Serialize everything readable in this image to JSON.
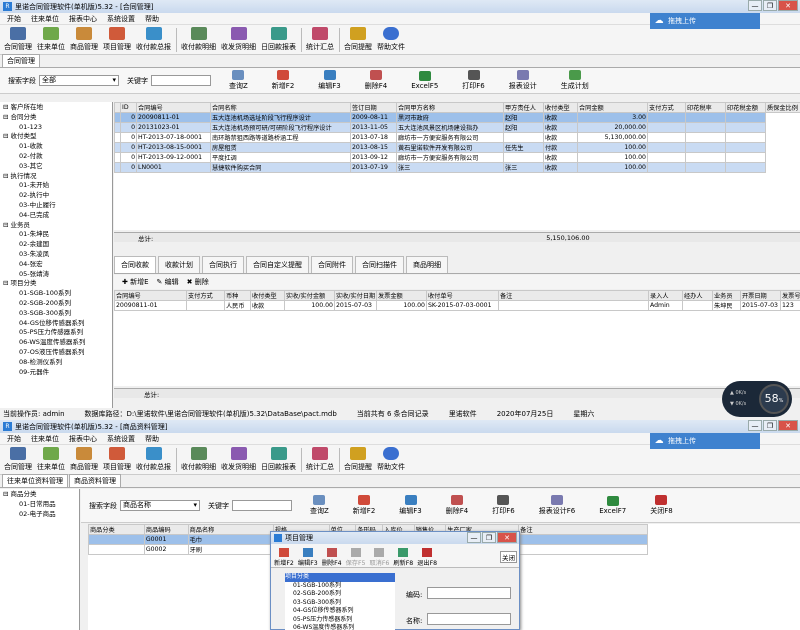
{
  "top": {
    "title": "里诺合同管理软件(单机版)5.32 - [合同管理]",
    "window_controls": [
      "—",
      "❐",
      "✕"
    ],
    "menu": [
      "开始",
      "往来单位",
      "报表中心",
      "系统设置",
      "帮助"
    ],
    "cloud_label": "拖拽上传",
    "toolbar": [
      "合同管理",
      "往来单位",
      "商品管理",
      "项目管理",
      "收付款总报",
      "收付款明细",
      "收发货明细",
      "日回款报表",
      "统计汇总",
      "合同提醒",
      "帮助文件"
    ],
    "doc_tab": "合同管理",
    "filter": {
      "field_label": "搜索字段",
      "field_value": "全部",
      "keyword_label": "关键字",
      "buttons": [
        "查询Z",
        "新增F2",
        "编辑F3",
        "删除F4",
        "ExcelF5",
        "打印F6",
        "报表设计",
        "生成计划"
      ]
    },
    "tree": [
      {
        "t": "⊟ 客户所在地",
        "lv": 0
      },
      {
        "t": "⊟ 合同分类",
        "lv": 0
      },
      {
        "t": "01-123",
        "lv": 2
      },
      {
        "t": "⊟ 收付类型",
        "lv": 0
      },
      {
        "t": "01-收款",
        "lv": 2
      },
      {
        "t": "02-付款",
        "lv": 2
      },
      {
        "t": "03-其它",
        "lv": 2
      },
      {
        "t": "⊟ 执行情况",
        "lv": 0
      },
      {
        "t": "01-未开始",
        "lv": 2
      },
      {
        "t": "02-执行中",
        "lv": 2
      },
      {
        "t": "03-中止履行",
        "lv": 2
      },
      {
        "t": "04-已完成",
        "lv": 2
      },
      {
        "t": "⊟ 业务员",
        "lv": 0
      },
      {
        "t": "01-朱坤民",
        "lv": 2
      },
      {
        "t": "02-余建国",
        "lv": 2
      },
      {
        "t": "03-朱凌凤",
        "lv": 2
      },
      {
        "t": "04-张宏",
        "lv": 2
      },
      {
        "t": "05-张靖涛",
        "lv": 2
      },
      {
        "t": "⊟ 项目分类",
        "lv": 0
      },
      {
        "t": "01-SGB-100系列",
        "lv": 2
      },
      {
        "t": "02-SGB-200系列",
        "lv": 2
      },
      {
        "t": "03-SGB-300系列",
        "lv": 2
      },
      {
        "t": "04-GS位移传感器系列",
        "lv": 2
      },
      {
        "t": "05-PS压力传感器系列",
        "lv": 2
      },
      {
        "t": "06-WS温度传感器系列",
        "lv": 2
      },
      {
        "t": "07-OS液压传感器系列",
        "lv": 2
      },
      {
        "t": "08-检测仪系列",
        "lv": 2
      },
      {
        "t": "09-元器件",
        "lv": 2
      }
    ],
    "grid_headers": [
      "ID",
      "合同编号",
      "合同名称",
      "签订日期",
      "合同甲方名称",
      "甲方责任人",
      "收付类型",
      "合同金额",
      "支付方式",
      "印花税率",
      "印花税金额",
      "质保金比例"
    ],
    "grid_rows": [
      {
        "c": [
          "",
          "0",
          "20090811-01",
          "五大连池机场选址阶段飞行程序设计",
          "2009-08-11",
          "黑河市政府",
          "赵阳",
          "收款",
          "3.00",
          "",
          "",
          ""
        ],
        "s": "sel"
      },
      {
        "c": [
          "",
          "0",
          "20131023-01",
          "五大连池机场预可研/可研阶段飞行程序设计",
          "2013-11-05",
          "五大连池风景区机场建设指办",
          "赵阳",
          "收款",
          "20,000.00",
          "",
          "",
          ""
        ],
        "s": "blue"
      },
      {
        "c": [
          "",
          "0",
          "HT-2013-07-18-0001",
          "南环路禁狙西路等道路桥涵工程",
          "2013-07-18",
          "廊坊市一方便安服务有限公司",
          "",
          "收款",
          "5,130,000.00",
          "",
          "",
          ""
        ],
        "s": ""
      },
      {
        "c": [
          "",
          "0",
          "HT-2013-08-15-0001",
          "房屋租赁",
          "2013-08-15",
          "黄石里诺软件开发有限公司",
          "任先生",
          "付款",
          "100.00",
          "",
          "",
          ""
        ],
        "s": "blue"
      },
      {
        "c": [
          "",
          "0",
          "HT-2013-09-12-0001",
          "平度扛调",
          "2013-09-12",
          "廊坊市一方便安服务有限公司",
          "",
          "收款",
          "100.00",
          "",
          "",
          ""
        ],
        "s": ""
      },
      {
        "c": [
          "",
          "0",
          "LN0001",
          "慧捷软件购买合同",
          "2013-07-19",
          "张三",
          "张三",
          "收款",
          "100.00",
          "",
          "",
          ""
        ],
        "s": "blue"
      }
    ],
    "total_label": "总计:",
    "total_value": "5,150,106.00",
    "sub_tabs": [
      "合同收款",
      "收款计划",
      "合同执行",
      "合同自定义提醒",
      "合同附件",
      "合同扫描件",
      "商品明细"
    ],
    "sub_buttons": [
      "新增E",
      "编辑",
      "删除"
    ],
    "sub_headers": [
      "合同编号",
      "支付方式",
      "币种",
      "收付类型",
      "实收/实付金额",
      "实收/实付日期",
      "发票金额",
      "收付单号",
      "备注",
      "录入人",
      "经办人",
      "业务员",
      "开票日期",
      "发票号"
    ],
    "sub_row": [
      "20090811-01",
      "",
      "人民币",
      "收款",
      "100.00",
      "2015-07-03",
      "100.00",
      "SK-2015-07-03-0001",
      "",
      "Admin",
      "",
      "朱坤民",
      "2015-07-03",
      "123"
    ],
    "sub_total": "总计:",
    "status": [
      "当前操作员: admin",
      "数据库路径：D:\\里诺软件\\里诺合同管理软件(单机版)5.32\\DataBase\\pact.mdb",
      "当前共有 6 条合同记录",
      "里诺软件",
      "2020年07月25日",
      "星期六"
    ]
  },
  "bottom": {
    "title": "里诺合同管理软件(单机版)5.32 - [商品资料管理]",
    "menu": [
      "开始",
      "往来单位",
      "报表中心",
      "系统设置",
      "帮助"
    ],
    "cloud_label": "拖拽上传",
    "toolbar": [
      "合同管理",
      "往来单位",
      "商品管理",
      "项目管理",
      "收付款总报",
      "收付款明细",
      "收发货明细",
      "日回款报表",
      "统计汇总",
      "合同提醒",
      "帮助文件"
    ],
    "doc_tabs": [
      "往来单位资料管理",
      "商品资料管理"
    ],
    "filter": {
      "field_label": "搜索字段",
      "field_value": "商品名称",
      "keyword_label": "关键字",
      "buttons": [
        "查询Z",
        "新增F2",
        "编辑F3",
        "删除F4",
        "打印F6",
        "报表设计F6",
        "ExcelF7",
        "关闭F8"
      ]
    },
    "tree": [
      {
        "t": "⊟ 商品分类",
        "lv": 0
      },
      {
        "t": "01-日常用品",
        "lv": 2
      },
      {
        "t": "02-电子商品",
        "lv": 2
      }
    ],
    "grid_headers": [
      "商品分类",
      "商品编码",
      "商品名称",
      "规格",
      "单位",
      "条形码",
      "入库价",
      "销售价",
      "生产厂家",
      "备注"
    ],
    "grid_rows": [
      {
        "c": [
          "",
          "G0001",
          "毛巾",
          "",
          "",
          "",
          "",
          "",
          "",
          ""
        ],
        "s": "sel"
      },
      {
        "c": [
          "",
          "G0002",
          "牙刷",
          "",
          "",
          "",
          "",
          "",
          "",
          ""
        ],
        "s": ""
      }
    ]
  },
  "dialog": {
    "title": "项目管理",
    "buttons": [
      "新增F2",
      "编辑F3",
      "删除F4",
      "保存F5",
      "取消F6",
      "刷新F8",
      "退出F8"
    ],
    "close_label": "关闭",
    "tree": [
      {
        "t": "项目分类",
        "lv": 0
      },
      {
        "t": "01-SGB-100系列",
        "lv": 1
      },
      {
        "t": "02-SGB-200系列",
        "lv": 1
      },
      {
        "t": "03-SGB-300系列",
        "lv": 1
      },
      {
        "t": "04-GS位移传感器系列",
        "lv": 1
      },
      {
        "t": "05-PS压力传感器系列",
        "lv": 1
      },
      {
        "t": "06-WS温度传感器系列",
        "lv": 1
      }
    ],
    "field1": "编码:",
    "field2": "名称:"
  },
  "speed": {
    "percent": "58",
    "up": "0K/s",
    "down": "0K/s"
  },
  "colors": {
    "accent": "#3f82cf",
    "selection": "#9dc0ea",
    "alt_row": "#c9dbf3"
  }
}
